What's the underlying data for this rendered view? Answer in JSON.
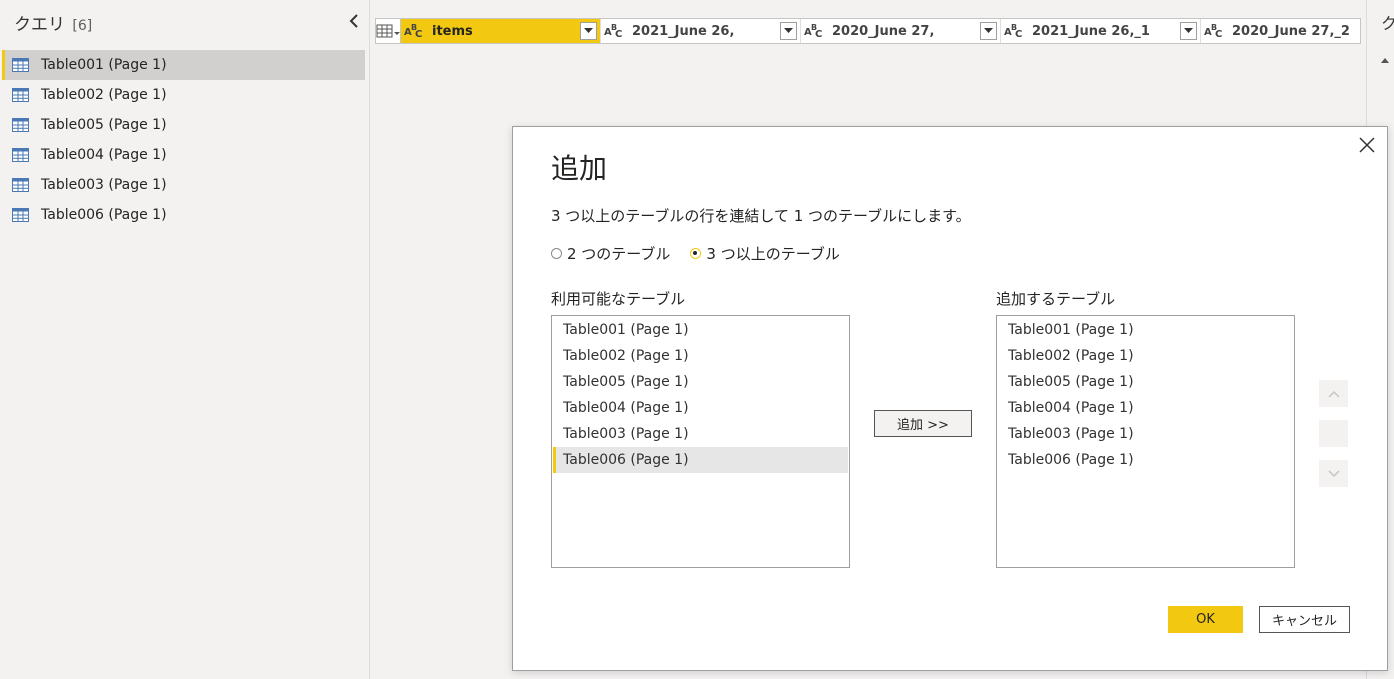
{
  "queries_pane": {
    "title": "クエリ",
    "count": "[6]",
    "items": [
      {
        "label": "Table001 (Page 1)",
        "selected": true
      },
      {
        "label": "Table002 (Page 1)",
        "selected": false
      },
      {
        "label": "Table005 (Page 1)",
        "selected": false
      },
      {
        "label": "Table004 (Page 1)",
        "selected": false
      },
      {
        "label": "Table003 (Page 1)",
        "selected": false
      },
      {
        "label": "Table006 (Page 1)",
        "selected": false
      }
    ]
  },
  "columns": [
    {
      "type_icon": "ABC",
      "name": "items",
      "selected": true
    },
    {
      "type_icon": "ABC",
      "name": "2021_June 26,",
      "selected": false
    },
    {
      "type_icon": "ABC",
      "name": "2020_June 27,",
      "selected": false
    },
    {
      "type_icon": "ABC",
      "name": "2021_June 26,_1",
      "selected": false
    },
    {
      "type_icon": "ABC",
      "name": "2020_June 27,_2",
      "selected": false
    }
  ],
  "right_pane": {
    "title_fragment": "ク"
  },
  "dialog": {
    "title": "追加",
    "description": "3 つ以上のテーブルの行を連結して 1 つのテーブルにします。",
    "radio_two": "2 つのテーブル",
    "radio_three": "3 つ以上のテーブル",
    "radio_selected": "three",
    "available_label": "利用可能なテーブル",
    "added_label": "追加するテーブル",
    "available": [
      "Table001 (Page 1)",
      "Table002 (Page 1)",
      "Table005 (Page 1)",
      "Table004 (Page 1)",
      "Table003 (Page 1)",
      "Table006 (Page 1)"
    ],
    "available_selected_index": 5,
    "added": [
      "Table001 (Page 1)",
      "Table002 (Page 1)",
      "Table005 (Page 1)",
      "Table004 (Page 1)",
      "Table003 (Page 1)",
      "Table006 (Page 1)"
    ],
    "add_button": "追加 >>",
    "ok_button": "OK",
    "cancel_button": "キャンセル"
  },
  "colors": {
    "accent": "#f2c811",
    "selection_gray": "#d2d0ce",
    "background": "#f3f2f1"
  }
}
